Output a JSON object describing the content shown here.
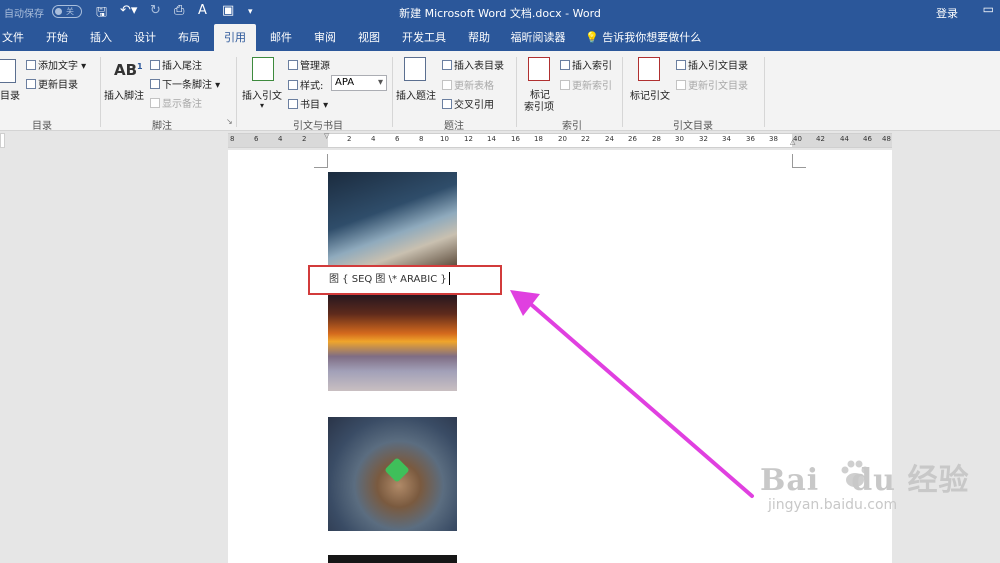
{
  "titlebar": {
    "autosave": "自动保存",
    "autosave_state": "关",
    "doc_title": "新建 Microsoft Word 文档.docx  -  Word",
    "login": "登录"
  },
  "tabs": [
    {
      "label": "文件"
    },
    {
      "label": "开始"
    },
    {
      "label": "插入"
    },
    {
      "label": "设计"
    },
    {
      "label": "布局"
    },
    {
      "label": "引用"
    },
    {
      "label": "邮件"
    },
    {
      "label": "审阅"
    },
    {
      "label": "视图"
    },
    {
      "label": "开发工具"
    },
    {
      "label": "帮助"
    },
    {
      "label": "福昕阅读器"
    }
  ],
  "tell_me": "告诉我你想要做什么",
  "ribbon": {
    "toc": {
      "big": "目录",
      "add_text": "添加文字",
      "update": "更新目录",
      "group": "目录"
    },
    "footnote": {
      "insert_footnote": "插入脚注",
      "insert_endnote": "插入尾注",
      "next_footnote": "下一条脚注",
      "show_notes": "显示备注",
      "group": "脚注"
    },
    "citation": {
      "insert_citation": "插入引文",
      "manage_sources": "管理源",
      "style_label": "样式:",
      "style_value": "APA",
      "bibliography": "书目",
      "group": "引文与书目"
    },
    "caption": {
      "insert_caption": "插入题注",
      "insert_table_of_figures": "插入表目录",
      "update_table": "更新表格",
      "cross_reference": "交叉引用",
      "group": "题注"
    },
    "index": {
      "mark_entry_line1": "标记",
      "mark_entry_line2": "索引项",
      "insert_index": "插入索引",
      "update_index": "更新索引",
      "group": "索引"
    },
    "authorities": {
      "mark_citation": "标记引文",
      "insert_table": "插入引文目录",
      "update_table": "更新引文目录",
      "group": "引文目录"
    }
  },
  "ruler_ticks": [
    "8",
    "6",
    "4",
    "2",
    "2",
    "4",
    "6",
    "8",
    "10",
    "12",
    "14",
    "16",
    "18",
    "20",
    "22",
    "24",
    "26",
    "28",
    "30",
    "32",
    "34",
    "36",
    "38",
    "40",
    "42",
    "44",
    "46",
    "48"
  ],
  "document": {
    "field_code": "图 { SEQ 图 \\* ARABIC }"
  },
  "watermark": {
    "brand": "Bai",
    "brand2": "du",
    "chinese": "经验",
    "url": "jingyan.baidu.com"
  },
  "colors": {
    "accent": "#2b579a",
    "highlight_box": "#d23b3b",
    "arrow": "#e040e0"
  }
}
